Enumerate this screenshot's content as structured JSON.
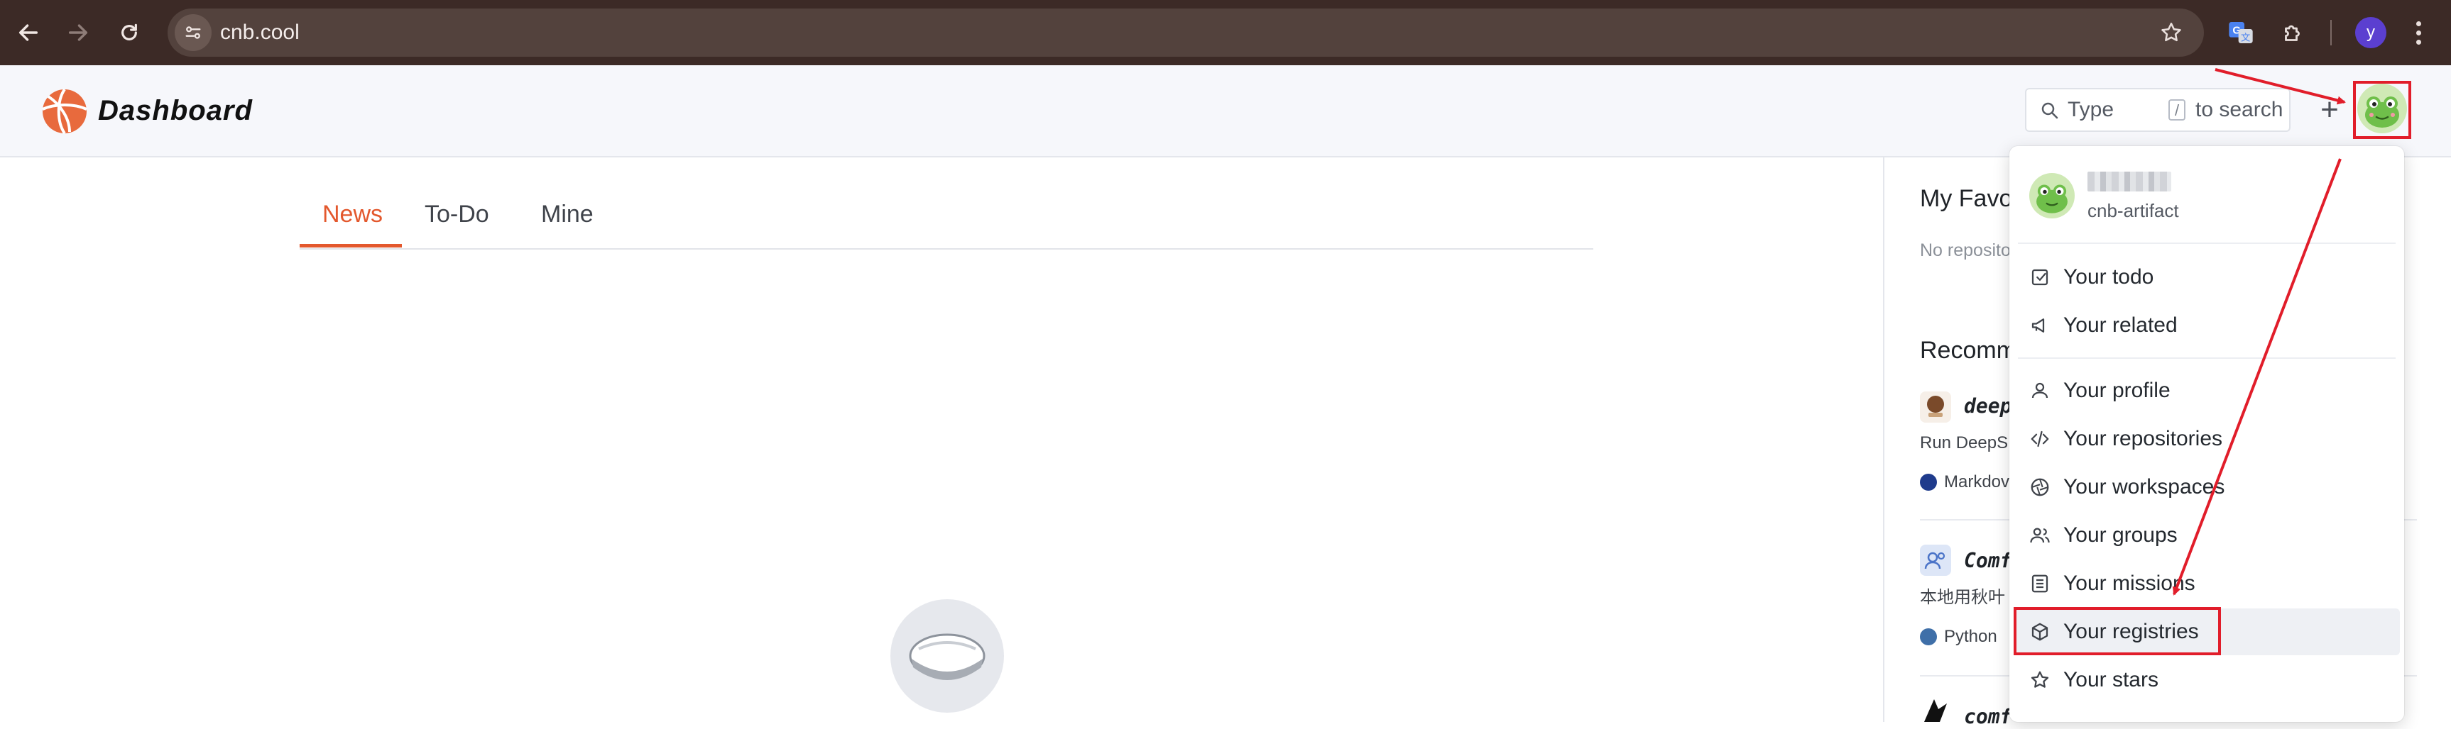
{
  "browser": {
    "url": "cnb.cool",
    "profile_initial": "y"
  },
  "header": {
    "title": "Dashboard",
    "search": {
      "prefix": "Type",
      "shortcut_key": "/",
      "suffix": "to search"
    },
    "plus_label": "+"
  },
  "main": {
    "tabs": [
      {
        "label": "News",
        "active": true
      },
      {
        "label": "To-Do",
        "active": false
      },
      {
        "label": "Mine",
        "active": false
      }
    ]
  },
  "sidebar": {
    "favorites_title": "My Favor",
    "favorites_empty": "No reposito",
    "recommend_title": "Recomm",
    "repos": [
      {
        "name": "deep",
        "desc": "Run DeepS",
        "language": "Markdov",
        "lang_color": "#1f3b8c"
      },
      {
        "name": "Comf",
        "desc": "本地用秋叶",
        "language": "Python",
        "lang_color": "#3f6fa8"
      },
      {
        "name": "comf"
      }
    ]
  },
  "user_menu": {
    "handle": "cnb-artifact",
    "items": [
      {
        "label": "Your todo",
        "icon": "todo-icon"
      },
      {
        "label": "Your related",
        "icon": "megaphone-icon"
      },
      {
        "label": "Your profile",
        "icon": "person-icon"
      },
      {
        "label": "Your repositories",
        "icon": "code-icon"
      },
      {
        "label": "Your workspaces",
        "icon": "aperture-icon"
      },
      {
        "label": "Your groups",
        "icon": "group-icon"
      },
      {
        "label": "Your missions",
        "icon": "list-icon"
      },
      {
        "label": "Your registries",
        "icon": "package-icon",
        "highlighted": true
      },
      {
        "label": "Your stars",
        "icon": "star-icon"
      }
    ]
  },
  "colors": {
    "accent": "#e3582d",
    "annotation_red": "#e11d2a",
    "browser_frame": "#3c2a26"
  }
}
